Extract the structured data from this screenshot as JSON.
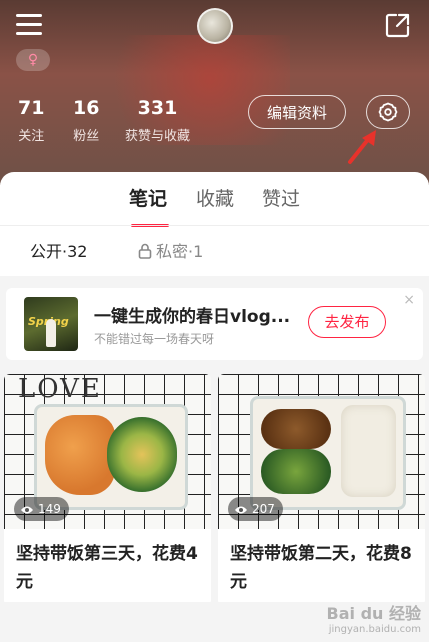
{
  "profile": {
    "gender_symbol": "♀",
    "stats": [
      {
        "num": "71",
        "label": "关注"
      },
      {
        "num": "16",
        "label": "粉丝"
      },
      {
        "num": "331",
        "label": "获赞与收藏"
      }
    ],
    "edit_label": "编辑资料"
  },
  "tabs": [
    {
      "label": "笔记",
      "active": true
    },
    {
      "label": "收藏",
      "active": false
    },
    {
      "label": "赞过",
      "active": false
    }
  ],
  "filters": {
    "public": "公开·32",
    "private": "私密·1"
  },
  "promo": {
    "thumb_text": "Spring",
    "title": "一键生成你的春日vlog...",
    "subtitle": "不能错过每一场春天呀",
    "button": "去发布",
    "close": "×"
  },
  "cards": [
    {
      "image_text": "LOVE",
      "views": "149",
      "title": "坚持带饭第三天，花费4元"
    },
    {
      "views": "207",
      "title": "坚持带饭第二天，花费8元"
    }
  ],
  "watermark": {
    "brand": "Bai du 经验",
    "url": "jingyan.baidu.com"
  },
  "colors": {
    "accent": "#ff2442",
    "arrow": "#e8322b"
  }
}
